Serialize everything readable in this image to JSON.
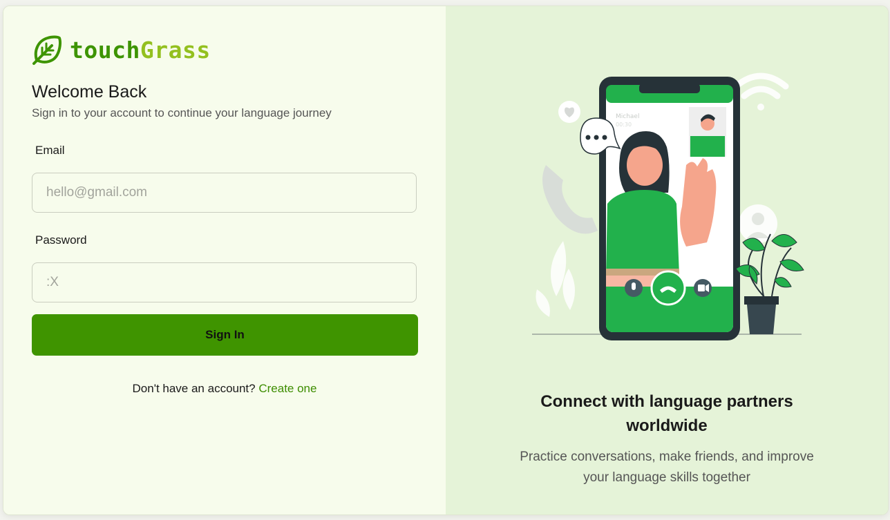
{
  "brand": {
    "name_part1": "touch",
    "name_part2": "Grass",
    "logo_icon": "leaf-icon",
    "primary_color": "#3d9400",
    "accent_color": "#93c01f"
  },
  "login": {
    "title": "Welcome Back",
    "subtitle": "Sign in to your account to continue your language journey",
    "email_label": "Email",
    "email_placeholder": "hello@gmail.com",
    "password_label": "Password",
    "password_placeholder": ":X",
    "submit_label": "Sign In",
    "signup_prompt": "Don't have an account?",
    "signup_link": "Create one",
    "button_color": "#3f9400"
  },
  "illustration": {
    "caller_name": "Michael",
    "call_time": "00:30"
  },
  "promo": {
    "title_line1": "Connect with language partners",
    "title_line2": "worldwide",
    "text_line1": "Practice conversations, make friends, and improve",
    "text_line2": "your language skills together"
  }
}
